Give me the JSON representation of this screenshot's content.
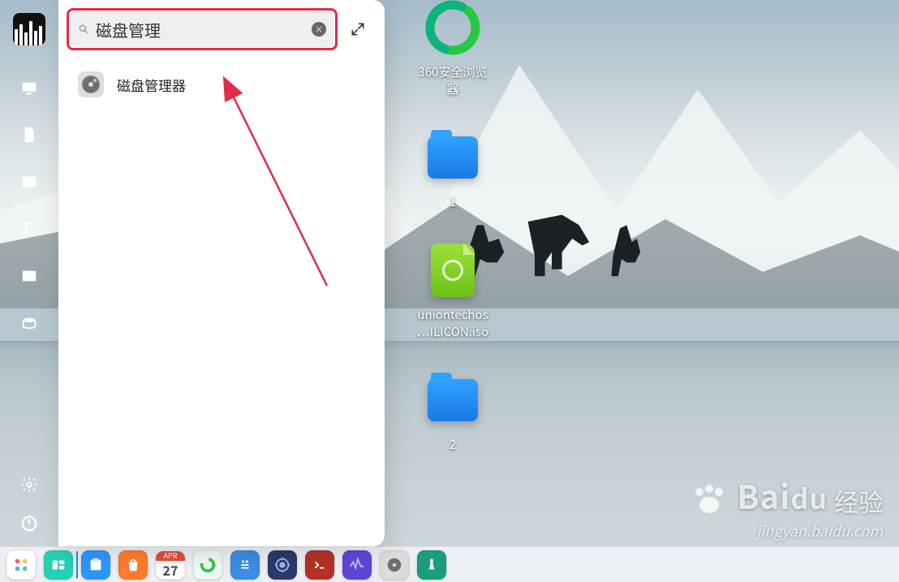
{
  "sidebar": {
    "categories": [
      {
        "name": "computer",
        "label": "计算机"
      },
      {
        "name": "documents",
        "label": "文档"
      },
      {
        "name": "pictures",
        "label": "图片"
      },
      {
        "name": "music",
        "label": "音乐"
      },
      {
        "name": "videos",
        "label": "视频"
      },
      {
        "name": "downloads",
        "label": "下载"
      }
    ],
    "settings_label": "设置",
    "power_label": "电源"
  },
  "launcher": {
    "search_value": "磁盘管理",
    "clear_label": "×",
    "results": [
      {
        "label": "磁盘管理器",
        "icon_name": "disk-manager-icon"
      }
    ]
  },
  "desktop": {
    "items": [
      {
        "label": "360安全浏览\n器",
        "kind": "browser360",
        "icon_name": "360-browser-icon"
      },
      {
        "label": "1",
        "kind": "folder",
        "icon_name": "folder-icon"
      },
      {
        "label": "uniontechos\n…ILICON.iso",
        "kind": "iso",
        "icon_name": "iso-file-icon"
      },
      {
        "label": "2",
        "kind": "folder",
        "icon_name": "folder-icon"
      }
    ]
  },
  "dock": {
    "items": [
      {
        "name": "launcher",
        "color": "#fff",
        "active": false
      },
      {
        "name": "multitask",
        "color": "#24d1b3",
        "active": false
      },
      {
        "name": "file-manager",
        "color": "#2d95ff",
        "active": true
      },
      {
        "name": "app-store",
        "color": "#ff7a2d",
        "active": false
      },
      {
        "name": "calendar",
        "color": "#ffffff",
        "active": false,
        "month": "APR",
        "day": "27"
      },
      {
        "name": "browser-360",
        "color": "#e8f7ef",
        "active": false
      },
      {
        "name": "text-editor",
        "color": "#3a8de0",
        "active": false
      },
      {
        "name": "control-center",
        "color": "#2b3a66",
        "active": false
      },
      {
        "name": "terminal",
        "color": "#b33126",
        "active": false
      },
      {
        "name": "system-monitor",
        "color": "#5f45d6",
        "active": false
      },
      {
        "name": "disk-manager",
        "color": "#dcdcdc",
        "active": false
      },
      {
        "name": "device-manager",
        "color": "#1a9e7a",
        "active": false
      }
    ]
  },
  "watermark": {
    "brand_main": "Bai",
    "brand_du": "du",
    "brand_suffix": "经验",
    "url": "jingyan.baidu.com"
  },
  "calendar": {
    "month": "APR",
    "day": "27"
  }
}
